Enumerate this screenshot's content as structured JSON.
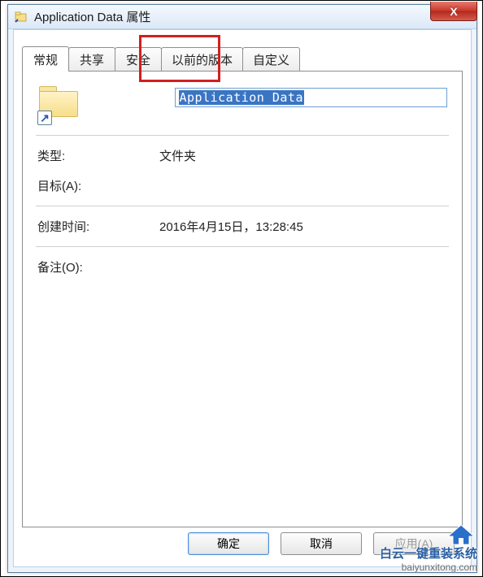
{
  "window": {
    "title": "Application Data 属性",
    "close_symbol": "X"
  },
  "tabs": [
    {
      "label": "常规",
      "active": true
    },
    {
      "label": "共享",
      "active": false
    },
    {
      "label": "安全",
      "active": false
    },
    {
      "label": "以前的版本",
      "active": false
    },
    {
      "label": "自定义",
      "active": false
    }
  ],
  "highlight_tab_index": 2,
  "general": {
    "name_value": "Application Data",
    "type_label": "类型:",
    "type_value": "文件夹",
    "target_label": "目标(A):",
    "target_value": "",
    "created_label": "创建时间:",
    "created_value": "2016年4月15日，13:28:45",
    "comment_label": "备注(O):",
    "comment_value": "",
    "shortcut_arrow": "↗"
  },
  "buttons": {
    "ok": "确定",
    "cancel": "取消",
    "apply": "应用(A)"
  },
  "watermark": {
    "line1": "白云一键重装系统",
    "line2": "baiyunxitong.com"
  }
}
